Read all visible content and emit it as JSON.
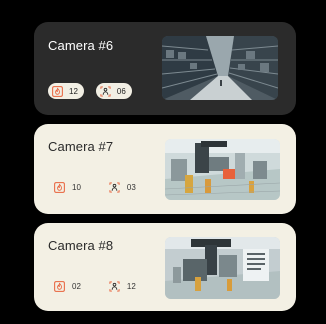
{
  "cameras": [
    {
      "title": "Camera #6",
      "theme": "dark",
      "alert_icon": "fire-alert-icon",
      "alert_count": "12",
      "person_icon": "person-detect-icon",
      "person_count": "06",
      "thumbnail": "warehouse-shelves-feed"
    },
    {
      "title": "Camera #7",
      "theme": "light",
      "alert_icon": "fire-alert-icon",
      "alert_count": "10",
      "person_icon": "person-detect-icon",
      "person_count": "03",
      "thumbnail": "factory-floor-feed"
    },
    {
      "title": "Camera #8",
      "theme": "light",
      "alert_icon": "fire-alert-icon",
      "alert_count": "02",
      "person_icon": "person-detect-icon",
      "person_count": "12",
      "thumbnail": "factory-machine-feed"
    }
  ],
  "colors": {
    "background": "#000000",
    "dark_card": "#2b2b2b",
    "light_card": "#f3f0e4",
    "alert_accent": "#e8613a"
  }
}
